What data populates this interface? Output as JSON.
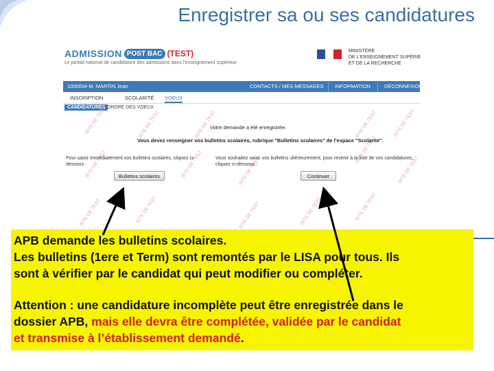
{
  "slide": {
    "title": "Enregistrer sa ou ses candidatures"
  },
  "apb": {
    "logo_admission": "ADMISSION",
    "logo_postbac": "POST BAC",
    "logo_test": "(TEST)",
    "tagline": "Le portail national de candidature des admissions dans l'enseignement supérieur",
    "ministry": "MINISTÈRE\nDE L'ENSEIGNEMENT SUPÉRIEUR\nET DE LA RECHERCHE",
    "user": "1000004 M. MARTIN Jean",
    "nav": [
      "CONTACTS / MES MESSAGES",
      "INFORMATION",
      "DÉCONNEXION"
    ],
    "tabs": [
      "INSCRIPTION",
      "SCOLARITÉ",
      "VOEUX"
    ],
    "subtabs": [
      "CANDIDATURES",
      "ORDRE DES VOEUX"
    ],
    "msg_registered": "Votre demande a été enregistrée.",
    "msg_instruction": "Vous devez renseigner vos bulletins scolaires, rubrique \"Bulletins scolaires\" de l'espace \"Scolarité\".",
    "left_text": "Pour saisir immédiatement vos bulletins scolaires, cliquez ci-dessous :",
    "right_text": "Vous souhaitez saisir vos bulletins ultérieurement, pour revenir à la liste de vos candidatures, cliquez ci-dessous :",
    "btn_bulletins": "Bulletins scolaires",
    "btn_continuer": "Continuer",
    "watermark": "SITE DE TEST"
  },
  "note": {
    "line1": "APB demande les bulletins scolaires.",
    "line2": "Les bulletins (1ere et Term)  sont remontés par le LISA pour tous. Ils",
    "line3": "sont à vérifier par le candidat qui peut modifier ou compléter.",
    "line4": "Attention : une candidature incomplète peut être enregistrée dans le",
    "line5_black": "dossier APB, ",
    "line5_red": "mais elle devra être complétée, validée par le candidat",
    "line6_red": "et transmise à l’établissement demandé",
    "line6_black": "."
  },
  "colors": {
    "title": "#3a6ea5",
    "highlight": "#f7f400",
    "red_text": "#d21f1f",
    "apb_blue": "#3f79b6"
  }
}
